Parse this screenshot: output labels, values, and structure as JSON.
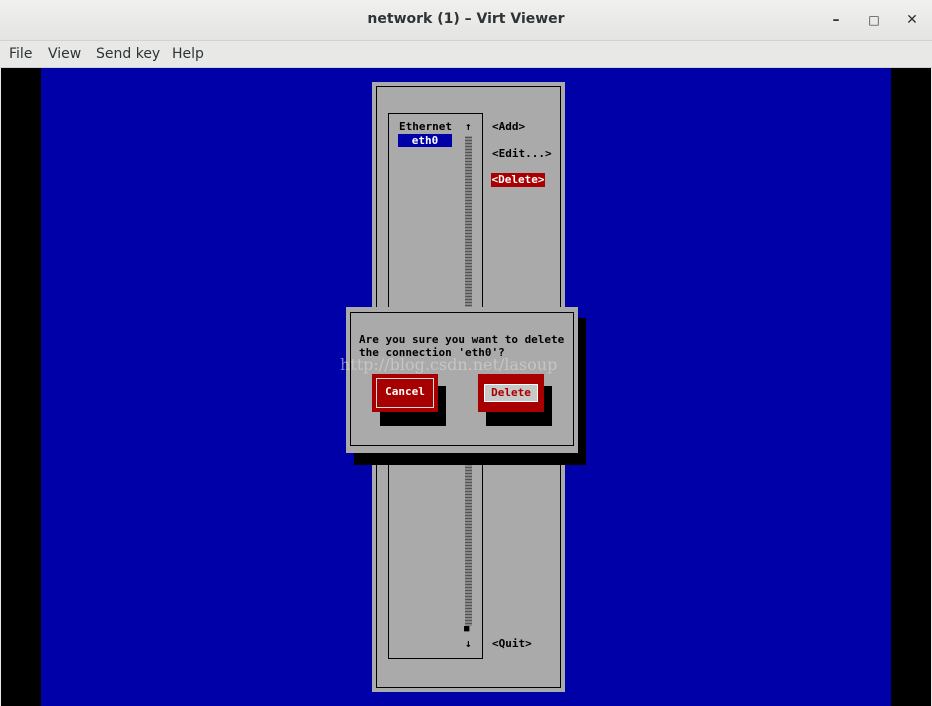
{
  "window": {
    "title": "network (1) – Virt Viewer",
    "minimize_glyph": "–",
    "maximize_glyph": "□",
    "close_glyph": "✕"
  },
  "menubar": {
    "items": [
      {
        "label": "File"
      },
      {
        "label": "View"
      },
      {
        "label": "Send key"
      },
      {
        "label": "Help"
      }
    ]
  },
  "nmtui": {
    "list_header": "Ethernet",
    "selected_item": "eth0",
    "scroll_up": "↑",
    "scroll_down": "↓",
    "scroll_thumb": "■",
    "actions": {
      "add": "<Add>",
      "edit": "<Edit...>",
      "delete": "<Delete>",
      "quit": "<Quit>"
    }
  },
  "dialog": {
    "line1": "Are you sure you want to delete",
    "line2": "the connection 'eth0'?",
    "cancel_label": "Cancel",
    "delete_label": "Delete"
  },
  "watermark": "http://blog.csdn.net/lasoup",
  "colors": {
    "console_blue": "#0000a8",
    "console_gray": "#aaaaaa",
    "console_red": "#a80000"
  }
}
